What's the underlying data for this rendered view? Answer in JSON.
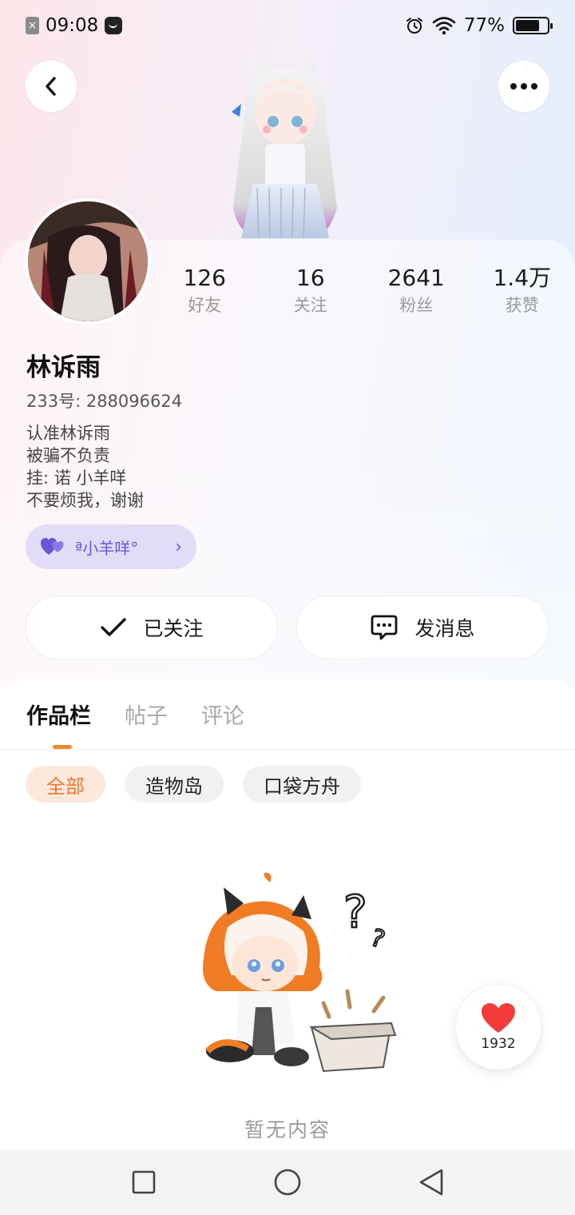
{
  "status_bar": {
    "time": "09:08",
    "battery": "77%",
    "battery_level": 0.77,
    "icons": [
      "sim-off-icon",
      "message-notification-icon",
      "alarm-icon",
      "wifi-icon",
      "battery-icon"
    ]
  },
  "header": {
    "back_icon": "chevron-left-icon",
    "more_icon": "more-dots-icon"
  },
  "profile": {
    "name": "林诉雨",
    "uid": "233号: 288096624",
    "bio": [
      "认准林诉雨",
      "被骗不负责",
      "挂: 诺 小羊咩",
      "不要烦我，谢谢"
    ],
    "stats": [
      {
        "value": "126",
        "label": "好友"
      },
      {
        "value": "16",
        "label": "关注"
      },
      {
        "value": "2641",
        "label": "粉丝"
      },
      {
        "value": "1.4万",
        "label": "获赞"
      }
    ],
    "club": {
      "label": "ª小羊咩°",
      "icon": "hearts-icon"
    }
  },
  "actions": {
    "follow_label": "已关注",
    "message_label": "发消息"
  },
  "tabs": [
    {
      "label": "作品栏",
      "active": true
    },
    {
      "label": "帖子",
      "active": false
    },
    {
      "label": "评论",
      "active": false
    }
  ],
  "filters": [
    {
      "label": "全部",
      "active": true
    },
    {
      "label": "造物岛",
      "active": false
    },
    {
      "label": "口袋方舟",
      "active": false
    }
  ],
  "empty_state": {
    "text": "暂无内容"
  },
  "like_fab": {
    "count": "1932"
  },
  "colors": {
    "accent_orange": "#ee7a2e",
    "club_purple": "#6a55d8",
    "heart_red": "#f23b3b"
  }
}
